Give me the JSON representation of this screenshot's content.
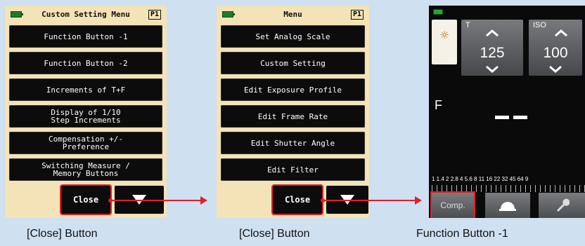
{
  "panel1": {
    "title": "Custom Setting Menu",
    "page": "P1",
    "items": [
      "Function Button -1",
      "Function Button -2",
      "Increments of T+F",
      "Display of 1/10\nStep Increments",
      "Compensation +/-\nPreference",
      "Switching Measure /\nMemory Buttons"
    ],
    "close_label": "Close",
    "next_icon": "triangle-down-icon"
  },
  "panel2": {
    "title": "Menu",
    "page": "P1",
    "items": [
      "Set Analog Scale",
      "Custom Setting",
      "Edit Exposure Profile",
      "Edit Frame Rate",
      "Edit Shutter Angle",
      "Edit Filter"
    ],
    "close_label": "Close",
    "next_icon": "triangle-down-icon"
  },
  "meter": {
    "mode_icon": "sun-icon",
    "t_label": "T",
    "t_value": "125",
    "iso_label": "ISO",
    "iso_value": "100",
    "f_label": "F",
    "f_value": "– –",
    "scale": "1  1.4  2  2.8  4  5.6  8  11  16  22  32  45  64  9",
    "comp_label": "Comp.",
    "memory_icon": "dome-icon",
    "tool_icon": "wrench-icon"
  },
  "captions": [
    "[Close] Button",
    "[Close] Button",
    "Function Button -1"
  ],
  "colors": {
    "panel_bg": "#f4e3b7",
    "highlight": "#e0202a",
    "page_bg": "#cfe0f1"
  }
}
